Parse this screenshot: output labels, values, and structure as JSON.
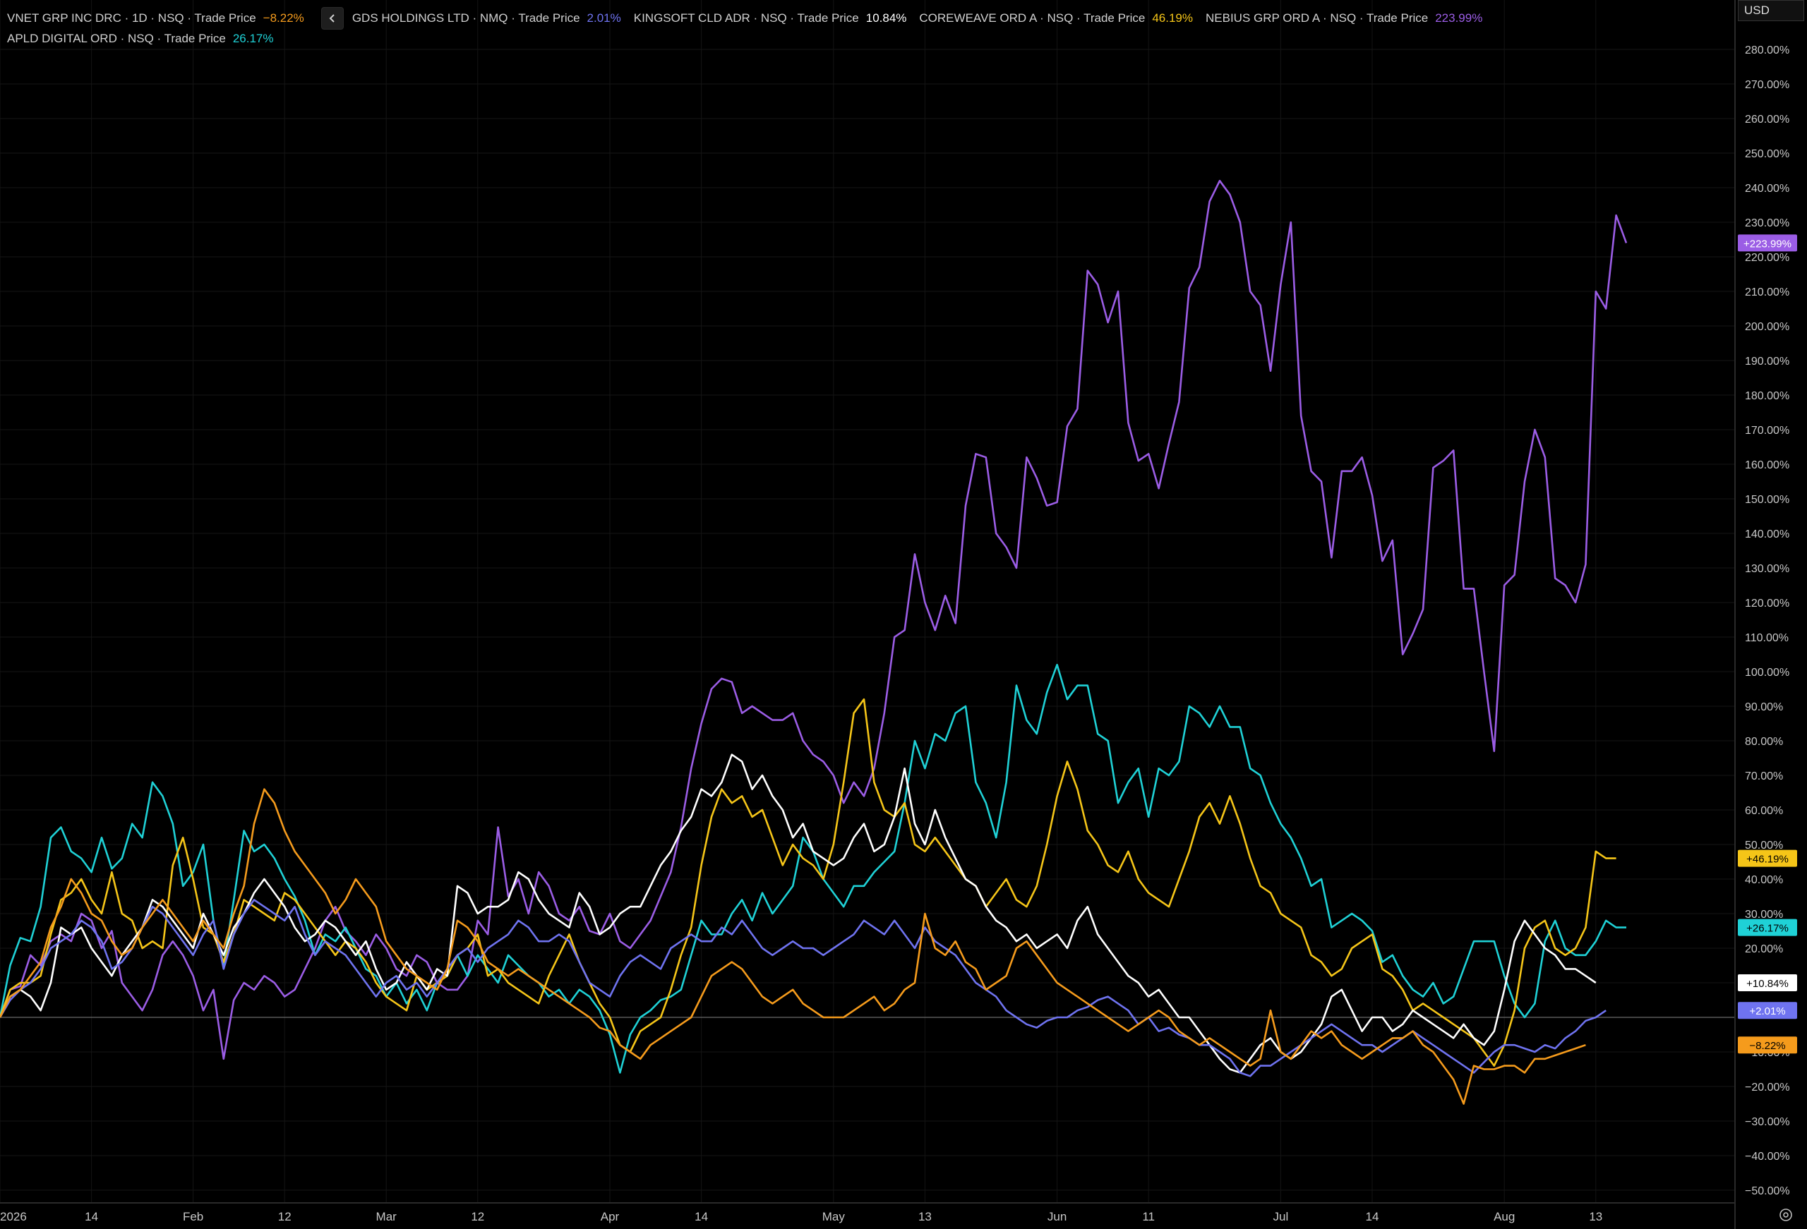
{
  "legend": {
    "row1": [
      {
        "name": "VNET GRP INC DRC · 1D · NSQ · Trade Price",
        "value": "−8.22%",
        "color": "#f59b1c"
      },
      {
        "name": "GDS HOLDINGS LTD · NMQ · Trade Price",
        "value": "2.01%",
        "color": "#6f73f0"
      },
      {
        "name": "KINGSOFT CLD ADR · NSQ · Trade Price",
        "value": "10.84%",
        "color": "#ffffff"
      },
      {
        "name": "COREWEAVE ORD A · NSQ · Trade Price",
        "value": "46.19%",
        "color": "#f5c518"
      },
      {
        "name": "NEBIUS GRP ORD A · NSQ · Trade Price",
        "value": "223.99%",
        "color": "#9b5de5"
      }
    ],
    "row2": [
      {
        "name": "APLD DIGITAL ORD · NSQ · Trade Price",
        "value": "26.17%",
        "color": "#1fd1d6"
      }
    ],
    "collapse_icon": "chevron-left-icon"
  },
  "axis": {
    "currency": "USD",
    "settings_icon": "gear-icon"
  },
  "chart_data": {
    "type": "line",
    "ylim": [
      -50,
      285
    ],
    "y_ticks": [
      280,
      270,
      260,
      250,
      240,
      230,
      220,
      210,
      200,
      190,
      180,
      170,
      160,
      150,
      140,
      130,
      120,
      110,
      100,
      90,
      80,
      70,
      60,
      50,
      40,
      30,
      20,
      10,
      -10,
      -20,
      -30,
      -40,
      -50
    ],
    "y_tick_labels": [
      "280.00%",
      "270.00%",
      "260.00%",
      "250.00%",
      "240.00%",
      "230.00%",
      "220.00%",
      "210.00%",
      "200.00%",
      "190.00%",
      "180.00%",
      "170.00%",
      "160.00%",
      "150.00%",
      "140.00%",
      "130.00%",
      "120.00%",
      "110.00%",
      "100.00%",
      "90.00%",
      "80.00%",
      "70.00%",
      "60.00%",
      "50.00%",
      "40.00%",
      "30.00%",
      "20.00%",
      "10.00%",
      "−10.00%",
      "−20.00%",
      "−30.00%",
      "−40.00%",
      "−50.00%"
    ],
    "x_ticks": [
      {
        "label": "2026",
        "x": 0
      },
      {
        "label": "14",
        "x": 9
      },
      {
        "label": "Feb",
        "x": 19
      },
      {
        "label": "12",
        "x": 28
      },
      {
        "label": "Mar",
        "x": 38
      },
      {
        "label": "12",
        "x": 47
      },
      {
        "label": "Apr",
        "x": 60
      },
      {
        "label": "14",
        "x": 69
      },
      {
        "label": "May",
        "x": 82
      },
      {
        "label": "13",
        "x": 91
      },
      {
        "label": "Jun",
        "x": 104
      },
      {
        "label": "11",
        "x": 113
      },
      {
        "label": "Jul",
        "x": 126
      },
      {
        "label": "14",
        "x": 135
      },
      {
        "label": "Aug",
        "x": 148
      },
      {
        "label": "13",
        "x": 157
      }
    ],
    "x_range": [
      0,
      166
    ],
    "series": [
      {
        "name": "NEBIUS GRP ORD A",
        "color": "#9b5de5",
        "last_label": "+223.99%",
        "label_text_color": "#ffffff",
        "values": [
          0,
          8,
          9,
          18,
          15,
          22,
          24,
          22,
          30,
          28,
          20,
          25,
          10,
          6,
          2,
          8,
          18,
          22,
          18,
          12,
          2,
          8,
          -12,
          5,
          10,
          8,
          12,
          10,
          6,
          8,
          14,
          20,
          28,
          32,
          25,
          22,
          18,
          24,
          20,
          14,
          12,
          18,
          16,
          10,
          8,
          8,
          12,
          28,
          24,
          55,
          35,
          40,
          30,
          42,
          38,
          30,
          28,
          32,
          25,
          24,
          30,
          22,
          20,
          24,
          28,
          35,
          42,
          55,
          72,
          85,
          95,
          98,
          97,
          88,
          90,
          88,
          86,
          86,
          88,
          80,
          76,
          74,
          70,
          62,
          68,
          64,
          72,
          88,
          110,
          112,
          134,
          120,
          112,
          122,
          114,
          148,
          163,
          162,
          140,
          136,
          130,
          162,
          156,
          148,
          149,
          171,
          176,
          216,
          212,
          201,
          210,
          172,
          161,
          163,
          153,
          166,
          178,
          211,
          217,
          236,
          242,
          238,
          230,
          210,
          206,
          187,
          212,
          230,
          174,
          158,
          155,
          133,
          158,
          158,
          162,
          151,
          132,
          138,
          105,
          111,
          118,
          159,
          161,
          164,
          124,
          124,
          100,
          77,
          125,
          128,
          155,
          170,
          162,
          127,
          125,
          120,
          131,
          210,
          205,
          232,
          224
        ]
      },
      {
        "name": "APLD DIGITAL ORD",
        "color": "#1fd1d6",
        "last_label": "+26.17%",
        "label_text_color": "#000000",
        "values": [
          0,
          15,
          23,
          22,
          32,
          52,
          55,
          48,
          46,
          42,
          52,
          43,
          46,
          56,
          52,
          68,
          64,
          56,
          38,
          42,
          50,
          28,
          15,
          34,
          54,
          48,
          50,
          46,
          40,
          35,
          28,
          18,
          24,
          22,
          26,
          20,
          14,
          12,
          6,
          10,
          4,
          8,
          2,
          10,
          12,
          18,
          12,
          18,
          14,
          10,
          18,
          15,
          12,
          10,
          6,
          8,
          4,
          8,
          6,
          2,
          -5,
          -16,
          -5,
          0,
          2,
          5,
          6,
          8,
          18,
          28,
          24,
          24,
          30,
          34,
          28,
          36,
          30,
          34,
          38,
          52,
          48,
          40,
          36,
          32,
          38,
          38,
          42,
          45,
          48,
          62,
          80,
          72,
          82,
          80,
          88,
          90,
          68,
          62,
          52,
          68,
          96,
          86,
          82,
          94,
          102,
          92,
          96,
          96,
          82,
          80,
          62,
          68,
          72,
          58,
          72,
          70,
          74,
          90,
          88,
          84,
          90,
          84,
          84,
          72,
          70,
          62,
          56,
          52,
          46,
          38,
          40,
          26,
          28,
          30,
          28,
          25,
          16,
          18,
          12,
          8,
          6,
          10,
          4,
          6,
          14,
          22,
          22,
          22,
          12,
          4,
          0,
          4,
          22,
          28,
          20,
          18,
          18,
          22,
          28,
          26,
          26
        ]
      },
      {
        "name": "COREWEAVE ORD A",
        "color": "#f5c518",
        "last_label": "+46.19%",
        "label_text_color": "#000000",
        "values": [
          0,
          8,
          10,
          10,
          12,
          24,
          34,
          36,
          40,
          34,
          30,
          42,
          30,
          28,
          20,
          22,
          20,
          44,
          52,
          40,
          26,
          24,
          16,
          24,
          34,
          32,
          30,
          28,
          36,
          34,
          30,
          26,
          22,
          18,
          22,
          20,
          16,
          10,
          6,
          4,
          2,
          12,
          8,
          10,
          12,
          18,
          20,
          24,
          12,
          14,
          10,
          8,
          6,
          4,
          12,
          18,
          24,
          16,
          10,
          4,
          0,
          -8,
          -10,
          -4,
          -2,
          0,
          8,
          18,
          26,
          44,
          58,
          66,
          62,
          64,
          58,
          60,
          52,
          44,
          50,
          46,
          44,
          40,
          50,
          68,
          88,
          92,
          68,
          60,
          58,
          62,
          50,
          48,
          52,
          48,
          44,
          40,
          38,
          32,
          36,
          40,
          34,
          32,
          38,
          50,
          64,
          74,
          66,
          54,
          50,
          44,
          42,
          48,
          40,
          36,
          34,
          32,
          40,
          48,
          58,
          62,
          56,
          64,
          56,
          46,
          38,
          36,
          30,
          28,
          26,
          18,
          16,
          12,
          14,
          20,
          22,
          24,
          14,
          12,
          8,
          2,
          4,
          2,
          0,
          -2,
          -4,
          -6,
          -10,
          -14,
          -8,
          2,
          20,
          26,
          28,
          20,
          18,
          20,
          26,
          48,
          46,
          46
        ]
      },
      {
        "name": "KINGSOFT CLD ADR",
        "color": "#ffffff",
        "last_label": "+10.84%",
        "label_text_color": "#000000",
        "values": [
          0,
          6,
          8,
          6,
          2,
          10,
          26,
          24,
          26,
          20,
          16,
          12,
          18,
          22,
          26,
          34,
          32,
          28,
          24,
          20,
          30,
          24,
          18,
          26,
          30,
          36,
          40,
          36,
          32,
          26,
          22,
          24,
          28,
          26,
          22,
          18,
          22,
          14,
          8,
          10,
          16,
          12,
          8,
          14,
          12,
          38,
          36,
          30,
          32,
          32,
          34,
          42,
          40,
          34,
          30,
          28,
          26,
          36,
          32,
          24,
          26,
          30,
          32,
          32,
          38,
          44,
          48,
          54,
          58,
          66,
          64,
          68,
          76,
          74,
          66,
          70,
          64,
          60,
          52,
          56,
          48,
          46,
          44,
          46,
          52,
          56,
          48,
          50,
          58,
          72,
          56,
          50,
          60,
          52,
          46,
          40,
          38,
          32,
          28,
          26,
          22,
          24,
          20,
          22,
          24,
          20,
          28,
          32,
          24,
          20,
          16,
          12,
          10,
          6,
          8,
          4,
          0,
          0,
          -4,
          -8,
          -12,
          -15,
          -16,
          -12,
          -8,
          -6,
          -10,
          -12,
          -10,
          -6,
          -2,
          6,
          8,
          2,
          -4,
          0,
          0,
          -4,
          -2,
          2,
          0,
          -2,
          -4,
          -6,
          -2,
          -6,
          -8,
          -4,
          8,
          22,
          28,
          24,
          20,
          18,
          14,
          14,
          12,
          10
        ]
      },
      {
        "name": "GDS HOLDINGS LTD",
        "color": "#6f73f0",
        "last_label": "+2.01%",
        "label_text_color": "#ffffff",
        "values": [
          0,
          5,
          8,
          10,
          14,
          20,
          22,
          24,
          28,
          26,
          22,
          14,
          16,
          20,
          26,
          32,
          30,
          26,
          22,
          18,
          24,
          28,
          14,
          24,
          30,
          34,
          32,
          30,
          28,
          32,
          24,
          18,
          22,
          20,
          18,
          14,
          10,
          6,
          10,
          12,
          8,
          10,
          6,
          10,
          14,
          18,
          20,
          16,
          20,
          22,
          24,
          28,
          26,
          22,
          22,
          24,
          22,
          16,
          10,
          8,
          6,
          12,
          16,
          18,
          16,
          14,
          20,
          22,
          24,
          22,
          22,
          26,
          24,
          28,
          24,
          20,
          18,
          20,
          22,
          20,
          20,
          18,
          20,
          22,
          24,
          28,
          26,
          24,
          28,
          24,
          20,
          26,
          22,
          20,
          18,
          14,
          10,
          8,
          6,
          2,
          0,
          -2,
          -3,
          -1,
          0,
          0,
          2,
          3,
          5,
          6,
          4,
          2,
          -2,
          0,
          -4,
          -3,
          -5,
          -6,
          -8,
          -8,
          -10,
          -12,
          -16,
          -17,
          -14,
          -14,
          -12,
          -10,
          -8,
          -6,
          -4,
          -2,
          -4,
          -6,
          -8,
          -8,
          -10,
          -8,
          -6,
          -4,
          -6,
          -8,
          -10,
          -12,
          -14,
          -16,
          -13,
          -10,
          -8,
          -8,
          -9,
          -10,
          -8,
          -9,
          -6,
          -4,
          -1,
          0,
          2
        ]
      },
      {
        "name": "VNET GRP INC DRC",
        "color": "#f59b1c",
        "last_label": "−8.22%",
        "label_text_color": "#000000",
        "values": [
          0,
          6,
          8,
          12,
          16,
          26,
          32,
          40,
          36,
          30,
          28,
          22,
          18,
          20,
          26,
          30,
          34,
          30,
          26,
          22,
          28,
          24,
          20,
          30,
          38,
          56,
          66,
          62,
          54,
          48,
          44,
          40,
          36,
          30,
          34,
          40,
          36,
          32,
          22,
          18,
          14,
          12,
          10,
          8,
          14,
          28,
          26,
          22,
          16,
          14,
          12,
          14,
          12,
          10,
          8,
          6,
          4,
          2,
          0,
          -3,
          -4,
          -8,
          -10,
          -12,
          -8,
          -6,
          -4,
          -2,
          0,
          6,
          12,
          14,
          16,
          14,
          10,
          6,
          4,
          6,
          8,
          4,
          2,
          0,
          0,
          0,
          2,
          4,
          6,
          2,
          4,
          8,
          10,
          30,
          20,
          18,
          22,
          16,
          14,
          8,
          10,
          12,
          20,
          22,
          18,
          14,
          10,
          8,
          6,
          4,
          2,
          0,
          -2,
          -4,
          -2,
          0,
          2,
          0,
          -4,
          -6,
          -8,
          -6,
          -8,
          -10,
          -12,
          -14,
          -12,
          2,
          -10,
          -12,
          -8,
          -4,
          -6,
          -4,
          -8,
          -10,
          -12,
          -10,
          -8,
          -6,
          -6,
          -4,
          -8,
          -10,
          -14,
          -18,
          -25,
          -14,
          -15,
          -15,
          -14,
          -14,
          -16,
          -12,
          -12,
          -11,
          -10,
          -9,
          -8
        ]
      }
    ]
  }
}
